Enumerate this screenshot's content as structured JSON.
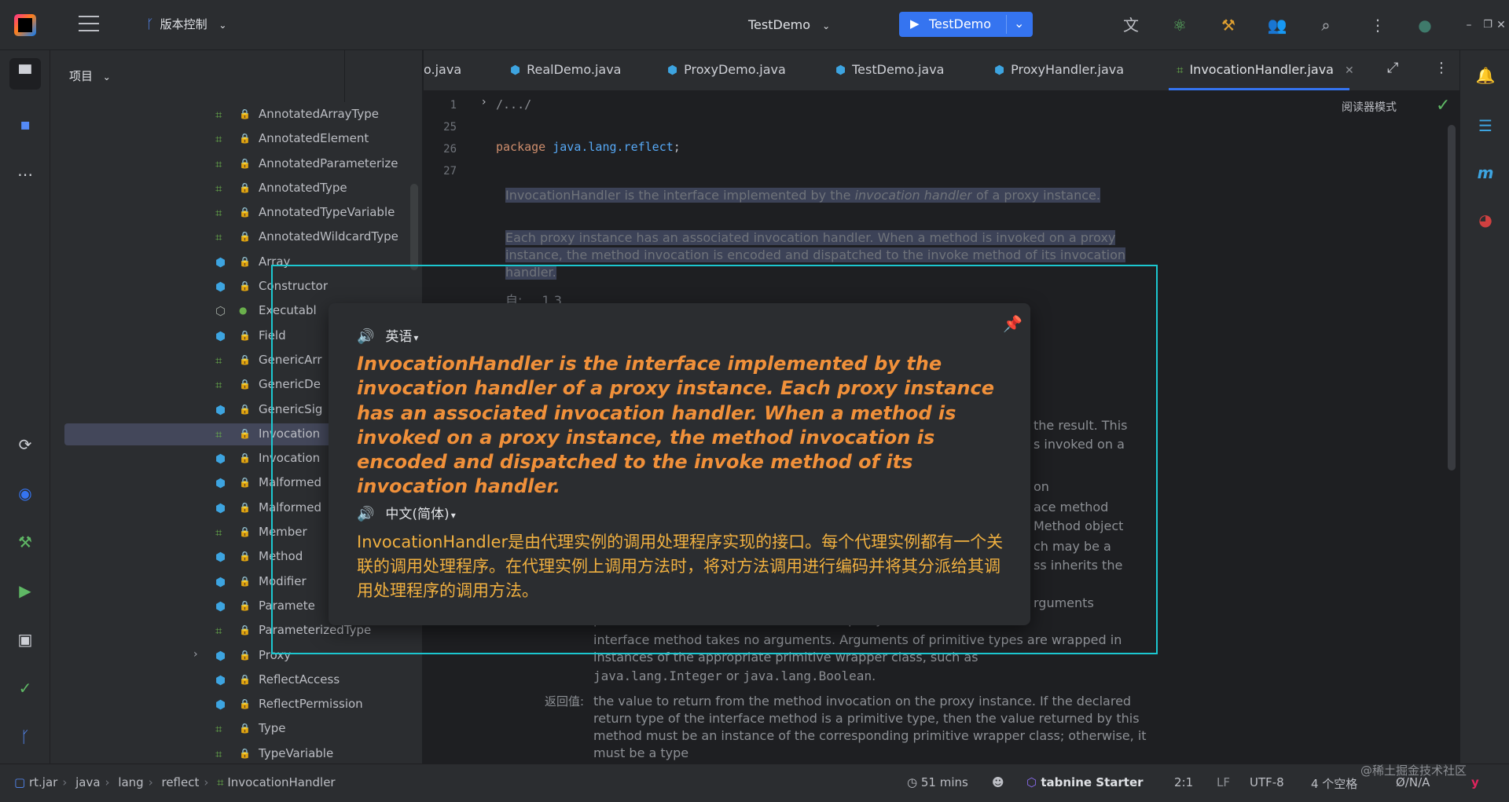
{
  "titlebar": {
    "vcs_label": "版本控制",
    "project_name": "TestDemo",
    "run_config": "TestDemo"
  },
  "project_panel": {
    "title": "项目",
    "items": [
      {
        "label": "AnnotatedArrayType",
        "kind": "interface"
      },
      {
        "label": "AnnotatedElement",
        "kind": "interface"
      },
      {
        "label": "AnnotatedParameterize",
        "kind": "interface"
      },
      {
        "label": "AnnotatedType",
        "kind": "interface"
      },
      {
        "label": "AnnotatedTypeVariable",
        "kind": "interface"
      },
      {
        "label": "AnnotatedWildcardType",
        "kind": "interface"
      },
      {
        "label": "Array",
        "kind": "class"
      },
      {
        "label": "Constructor",
        "kind": "class"
      },
      {
        "label": "Executabl",
        "kind": "abstract"
      },
      {
        "label": "Field",
        "kind": "class"
      },
      {
        "label": "GenericArr",
        "kind": "interface"
      },
      {
        "label": "GenericDe",
        "kind": "interface"
      },
      {
        "label": "GenericSig",
        "kind": "class"
      },
      {
        "label": "Invocation",
        "kind": "interface",
        "selected": true
      },
      {
        "label": "Invocation",
        "kind": "class"
      },
      {
        "label": "Malformed",
        "kind": "class"
      },
      {
        "label": "Malformed",
        "kind": "class"
      },
      {
        "label": "Member",
        "kind": "interface"
      },
      {
        "label": "Method",
        "kind": "class"
      },
      {
        "label": "Modifier",
        "kind": "class"
      },
      {
        "label": "Paramete",
        "kind": "class"
      },
      {
        "label": "ParameterizedType",
        "kind": "interface"
      },
      {
        "label": "Proxy",
        "kind": "class",
        "expandable": true
      },
      {
        "label": "ReflectAccess",
        "kind": "class"
      },
      {
        "label": "ReflectPermission",
        "kind": "class"
      },
      {
        "label": "Type",
        "kind": "interface"
      },
      {
        "label": "TypeVariable",
        "kind": "interface"
      }
    ]
  },
  "tabs": [
    {
      "label": "o.java"
    },
    {
      "label": "RealDemo.java"
    },
    {
      "label": "ProxyDemo.java"
    },
    {
      "label": "TestDemo.java"
    },
    {
      "label": "ProxyHandler.java"
    },
    {
      "label": "InvocationHandler.java",
      "active": true
    }
  ],
  "editor": {
    "line_numbers": [
      "1",
      "25",
      "26",
      "27"
    ],
    "fold_text": "/.../",
    "package_kw": "package",
    "package_name": "java.lang.reflect",
    "package_semicolon": ";",
    "reader_mode": "阅读器模式",
    "doc_p1_a": "InvocationHandler is the interface implemented by the ",
    "doc_p1_b": "invocation handler",
    "doc_p1_c": " of a proxy instance.",
    "doc_p2": "Each proxy instance has an associated invocation handler. When a method is invoked on a proxy instance, the method invocation is encoded and dispatched to the invoke method of its invocation handler.",
    "since_label": "自:",
    "since_value": "1.3",
    "right_frag_1": "the result. This",
    "right_frag_2": "s invoked on a",
    "right_frag_3": "on",
    "right_frag_4": "ace method",
    "right_frag_5": "Method object",
    "right_frag_6": "ch may be a",
    "right_frag_7": "ss inherits the",
    "right_frag_8": "rguments",
    "lower_1": "passed in the method invocation on the proxy instance, or null if",
    "lower_2": "interface method takes no arguments. Arguments of primitive types are wrapped in instances of the appropriate primitive wrapper class, such as",
    "lower_3a": "java.lang.Integer",
    "lower_3b": " or ",
    "lower_3c": "java.lang.Boolean",
    "lower_3d": ".",
    "returns_label": "返回值:",
    "returns_text": "the value to return from the method invocation on the proxy instance. If the declared return type of the interface method is a primitive type, then the value returned by this method must be an instance of the corresponding primitive wrapper class; otherwise, it must be a type"
  },
  "translation_popup": {
    "source_lang": "英语",
    "source_text": "InvocationHandler is the interface implemented by the invocation handler of a proxy instance. Each proxy instance has an associated invocation handler. When a method is invoked on a proxy instance, the method invocation is encoded and dispatched to the invoke method of its invocation handler.",
    "target_lang": "中文(简体)",
    "target_text": "InvocationHandler是由代理实例的调用处理程序实现的接口。每个代理实例都有一个关联的调用处理程序。在代理实例上调用方法时，将对方法调用进行编码并将其分派给其调用处理程序的调用方法。"
  },
  "statusbar": {
    "breadcrumb": [
      "rt.jar",
      "java",
      "lang",
      "reflect",
      "InvocationHandler"
    ],
    "time": "51 mins",
    "plugin_a": "tabnine",
    "plugin_b": "Starter",
    "position": "2:1",
    "line_sep": "LF",
    "encoding": "UTF-8",
    "indent": "4 个空格",
    "lock_status": "Ø/N/A"
  },
  "watermark": "@稀土掘金技术社区",
  "colors": {
    "accent": "#3574f0",
    "popup_source": "#f0903a",
    "popup_target": "#f0b040",
    "selection_frame": "#1cc7d0"
  }
}
